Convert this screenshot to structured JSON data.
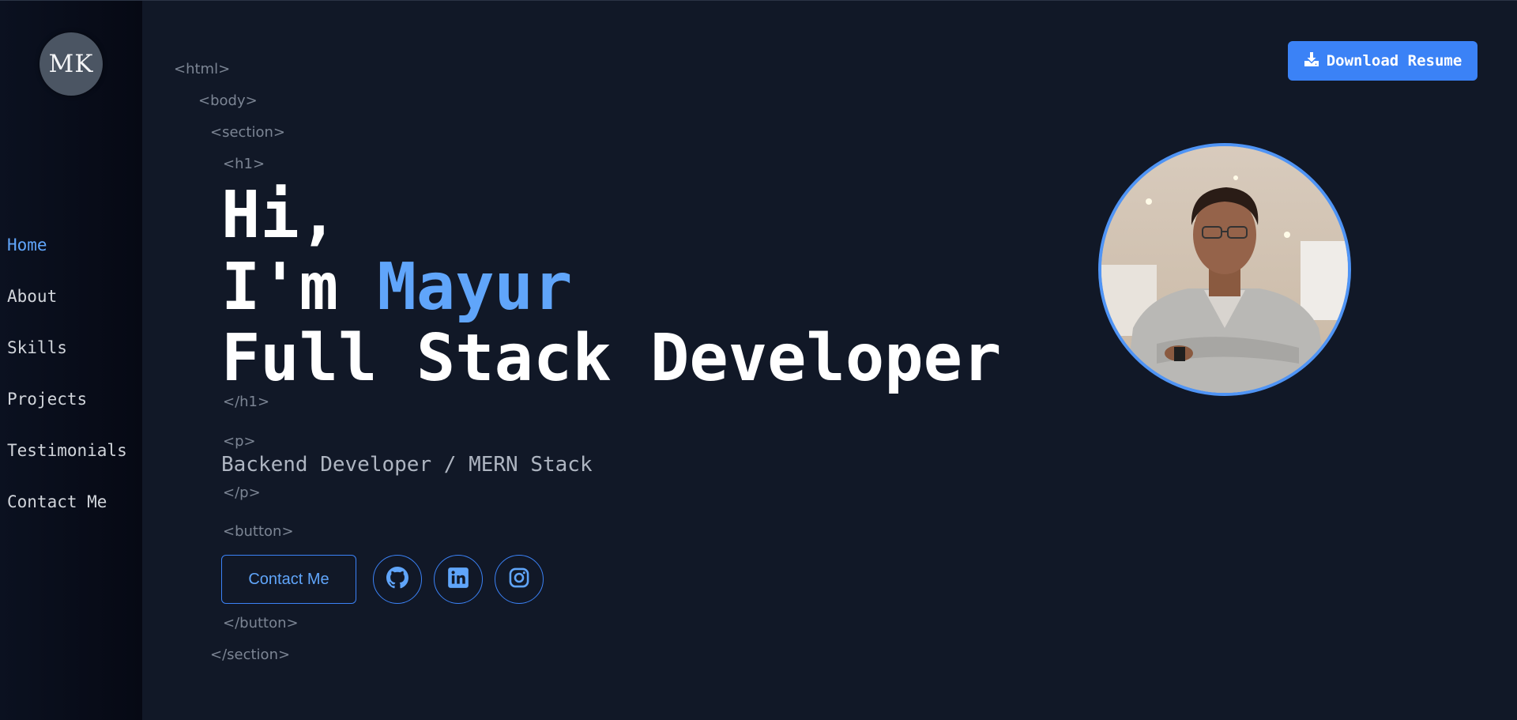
{
  "sidebar": {
    "logo": "MK",
    "items": [
      {
        "label": "Home",
        "active": true
      },
      {
        "label": "About",
        "active": false
      },
      {
        "label": "Skills",
        "active": false
      },
      {
        "label": "Projects",
        "active": false
      },
      {
        "label": "Testimonials",
        "active": false
      },
      {
        "label": "Contact Me",
        "active": false
      }
    ]
  },
  "header": {
    "download_label": "Download Resume",
    "download_icon": "download-icon"
  },
  "tags": {
    "html_open": "<html>",
    "body_open": "<body>",
    "section_open": "<section>",
    "h1_open": "<h1>",
    "h1_close": "</h1>",
    "p_open": "<p>",
    "p_close": "</p>",
    "button_open": "<button>",
    "button_close": "</button>",
    "section_close": "</section>"
  },
  "hero": {
    "greeting": "Hi,",
    "intro_prefix": "I'm ",
    "name": "Mayur",
    "role": "Full Stack Developer",
    "subtitle": "Backend Developer / MERN Stack"
  },
  "actions": {
    "contact_label": "Contact Me",
    "social_icons": [
      "github-icon",
      "linkedin-icon",
      "instagram-icon"
    ]
  },
  "colors": {
    "background": "#111827",
    "sidebar": "#0b1120",
    "accent": "#60a5fa",
    "button": "#3b82f6",
    "tag": "#7c8594"
  }
}
